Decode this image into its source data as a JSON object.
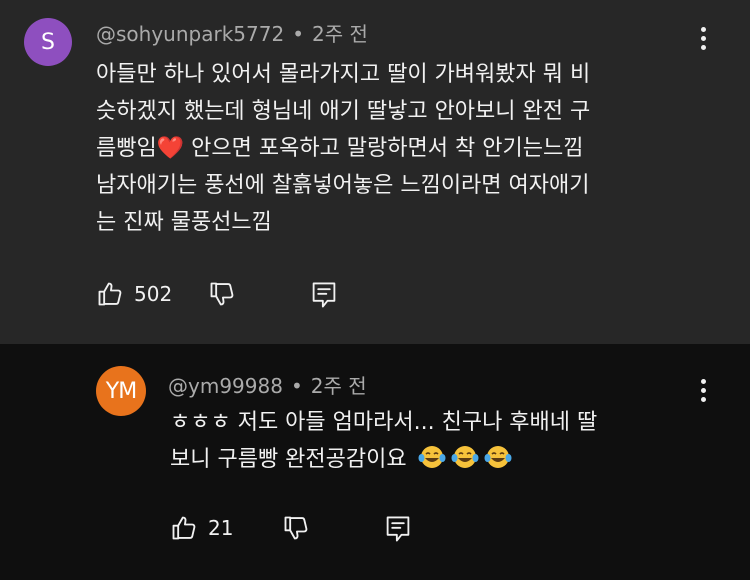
{
  "comment": {
    "avatar_letter": "S",
    "avatar_color": "#8e4fbf",
    "author": "@sohyunpark5772",
    "separator": "•",
    "time": "2주 전",
    "lines": [
      "아들만 하나 있어서 몰라가지고 딸이 가벼워봤자 뭐 비",
      "슷하겠지 했는데  형님네 애기 딸낳고 안아보니 완전 구",
      "남자애기는 풍선에 찰흙넣어놓은 느낌이라면 여자애기",
      "는 진짜 물풍선느낌"
    ],
    "line3_before": "름빵임",
    "heart_emoji": "❤️",
    "line3_after": " 안으면 포옥하고 말랑하면서 착 안기는느낌",
    "like_count": "502",
    "icons": {
      "like": "thumbs-up-icon",
      "dislike": "thumbs-down-icon",
      "reply": "reply-comment-icon",
      "more": "more-vertical-icon"
    }
  },
  "reply": {
    "avatar_letters": "YM",
    "avatar_color": "#e8731c",
    "author": "@ym99988",
    "separator": "•",
    "time": "2주 전",
    "line1": "ㅎㅎㅎ 저도 아들 엄마라서... 친구나 후배네 딸",
    "line2": "보니 구름빵 완전공감이요",
    "emoji": "tears-of-joy-emoji",
    "like_count": "21"
  }
}
